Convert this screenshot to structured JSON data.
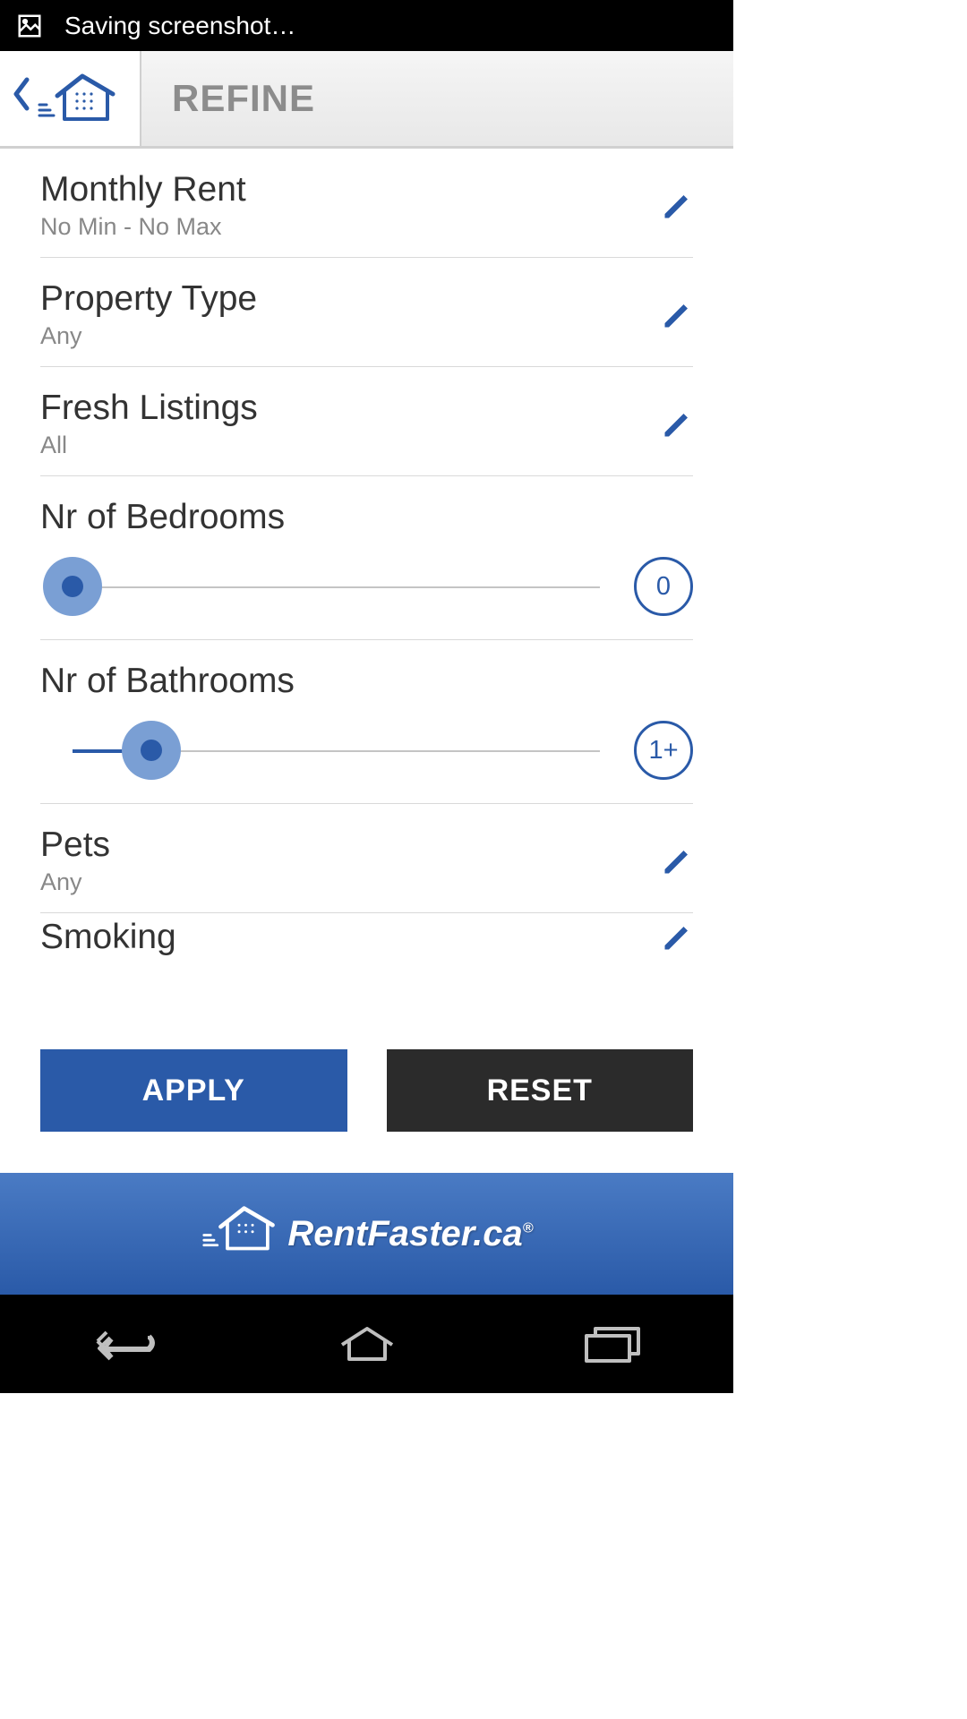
{
  "status": {
    "saving_text": "Saving screenshot…"
  },
  "header": {
    "title": "REFINE"
  },
  "filters": {
    "rent": {
      "label": "Monthly Rent",
      "value": "No Min - No Max"
    },
    "property": {
      "label": "Property Type",
      "value": "Any"
    },
    "fresh": {
      "label": "Fresh Listings",
      "value": "All"
    },
    "bedrooms": {
      "label": "Nr of Bedrooms",
      "badge": "0",
      "slider_percent": 0
    },
    "bathrooms": {
      "label": "Nr of Bathrooms",
      "badge": "1+",
      "slider_percent": 15
    },
    "pets": {
      "label": "Pets",
      "value": "Any"
    },
    "smoking": {
      "label": "Smoking"
    }
  },
  "buttons": {
    "apply": "APPLY",
    "reset": "RESET"
  },
  "brand": {
    "text": "RentFaster.ca",
    "reg": "®"
  }
}
